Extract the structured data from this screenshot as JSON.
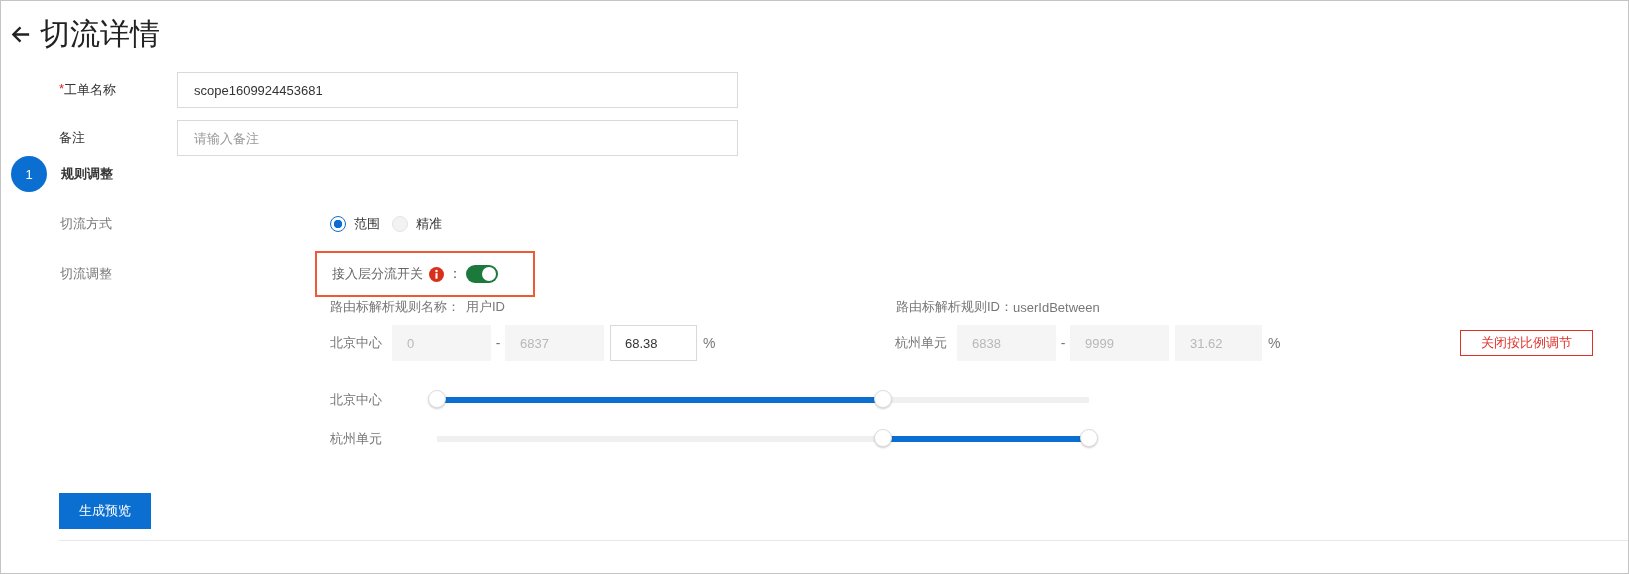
{
  "page": {
    "title": "切流详情"
  },
  "form": {
    "fields": [
      {
        "required_mark": "*",
        "label": "工单名称",
        "value": "scope1609924453681"
      },
      {
        "label": "备注",
        "placeholder": "请输入备注"
      }
    ]
  },
  "step": {
    "number": "1",
    "title": "规则调整"
  },
  "split_mode": {
    "label": "切流方式",
    "options": [
      {
        "label": "范围",
        "selected": true
      },
      {
        "label": "精准",
        "selected": false
      }
    ]
  },
  "split_adjust": {
    "label": "切流调整",
    "switch": {
      "label": "接入层分流开关",
      "separator": "：",
      "on": true
    },
    "rule_name": {
      "label": "路由标解析规则名称：",
      "value": "用户ID"
    },
    "rule_id": {
      "label": "路由标解析规则ID：",
      "value": "userIdBetween"
    },
    "ranges": [
      {
        "name": "北京中心",
        "from": "0",
        "dash": "-",
        "to": "6837",
        "percent": "68.38",
        "editable": true,
        "unit": "%"
      },
      {
        "name": "杭州单元",
        "from": "6838",
        "dash": "-",
        "to": "9999",
        "percent": "31.62",
        "editable": false,
        "unit": "%"
      }
    ],
    "ratio_button": "关闭按比例调节",
    "sliders": [
      {
        "label": "北京中心",
        "kind": "from_start",
        "level": 0.6838
      },
      {
        "label": "杭州单元",
        "kind": "to_end",
        "level": 0.3162
      }
    ]
  },
  "buttons": [
    {
      "label": "生成预览"
    }
  ]
}
